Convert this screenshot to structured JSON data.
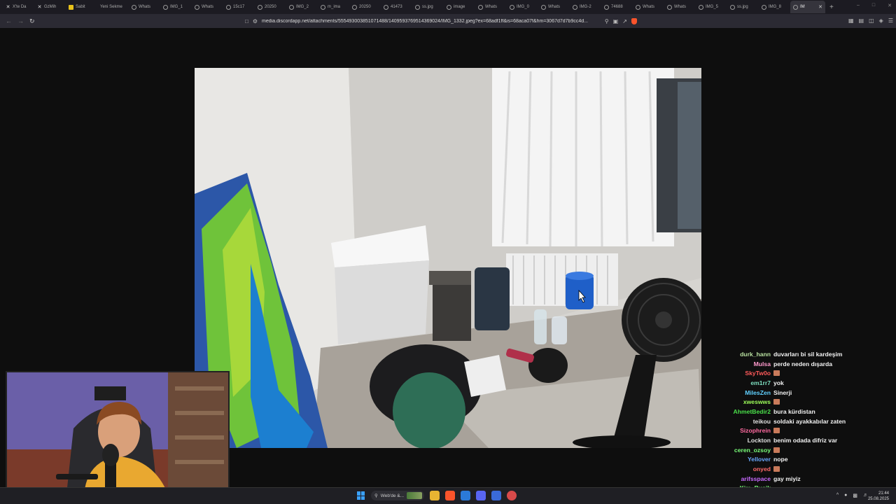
{
  "browser": {
    "tabs": [
      {
        "label": "X'te Da",
        "icon": "x-logo-icon"
      },
      {
        "label": "GzMih",
        "icon": "x-logo-icon"
      },
      {
        "label": "Sabit",
        "icon": "s-logo-icon"
      },
      {
        "label": "Yeni Sekme",
        "icon": "none"
      },
      {
        "label": "Whats",
        "icon": "globe-icon"
      },
      {
        "label": "IMG_1",
        "icon": "globe-icon"
      },
      {
        "label": "Whats",
        "icon": "globe-icon"
      },
      {
        "label": "15c17",
        "icon": "globe-icon"
      },
      {
        "label": "20250",
        "icon": "globe-icon"
      },
      {
        "label": "IMG_2",
        "icon": "globe-icon"
      },
      {
        "label": "m_ima",
        "icon": "globe-icon"
      },
      {
        "label": "20250",
        "icon": "globe-icon"
      },
      {
        "label": "41473",
        "icon": "globe-icon"
      },
      {
        "label": "ss.jpg",
        "icon": "globe-icon"
      },
      {
        "label": "image",
        "icon": "globe-icon"
      },
      {
        "label": "Whats",
        "icon": "globe-icon"
      },
      {
        "label": "IMG_0",
        "icon": "globe-icon"
      },
      {
        "label": "Whats",
        "icon": "globe-icon"
      },
      {
        "label": "IMG-2",
        "icon": "globe-icon"
      },
      {
        "label": "74688",
        "icon": "globe-icon"
      },
      {
        "label": "Whats",
        "icon": "globe-icon"
      },
      {
        "label": "Whats",
        "icon": "globe-icon"
      },
      {
        "label": "IMG_5",
        "icon": "globe-icon"
      },
      {
        "label": "ss.jpg",
        "icon": "globe-icon"
      },
      {
        "label": "IMG_8",
        "icon": "globe-icon"
      },
      {
        "label": "IM",
        "icon": "globe-icon",
        "active": true
      }
    ],
    "url": "media.discordapp.net/attachments/555493003851071488/1409593769514369024/IMG_1332.jpeg?ex=68adf1ff&is=68aca07f&hm=3067d7d7b9cc4d..."
  },
  "chat": [
    {
      "user": "durk_hann",
      "color": "#b8e0a0",
      "msg": "duvarları bi sil kardeşim",
      "emote": false
    },
    {
      "user": "Mulsa",
      "color": "#ff9acd",
      "msg": "perde neden dışarda",
      "emote": false
    },
    {
      "user": "SkyTw0o",
      "color": "#ff5a5a",
      "msg": "",
      "emote": true
    },
    {
      "user": "em1rr7",
      "color": "#7ee0c0",
      "msg": "yok",
      "emote": false
    },
    {
      "user": "MilesZen",
      "color": "#60d0ff",
      "msg": "Sinerji",
      "emote": false
    },
    {
      "user": "xweswws",
      "color": "#9eff5a",
      "msg": "",
      "emote": true
    },
    {
      "user": "AhmetBedir2",
      "color": "#4ae04a",
      "msg": "bura kürdistan",
      "emote": false
    },
    {
      "user": "teikou",
      "color": "#e0e0e0",
      "msg": "soldaki ayakkabılar zaten",
      "emote": false
    },
    {
      "user": "Sizophrein",
      "color": "#ff6aa0",
      "msg": "",
      "emote": true
    },
    {
      "user": "Lockton",
      "color": "#e0e0e0",
      "msg": "benim odada difriz var",
      "emote": false
    },
    {
      "user": "ceren_ozsoy",
      "color": "#7aff7a",
      "msg": "",
      "emote": true
    },
    {
      "user": "Yellover",
      "color": "#6aa8ff",
      "msg": "nope",
      "emote": false
    },
    {
      "user": "onyed",
      "color": "#ff6a6a",
      "msg": "",
      "emote": true
    },
    {
      "user": "arifsspace",
      "color": "#c86aff",
      "msg": "gay miyiz",
      "emote": false
    },
    {
      "user": "Kim_Busik",
      "color": "#7aff7a",
      "msg": "",
      "emote": false
    }
  ],
  "taskbar": {
    "search_text": "Web'de &...",
    "time": "21:44",
    "date": "25.08.2025"
  },
  "colors": {
    "background": "#0e0e0e",
    "tabbar": "#1c1b22",
    "toolbar": "#2b2a33",
    "taskbar": "#1f1f24",
    "accent": "#3aa0ff"
  }
}
